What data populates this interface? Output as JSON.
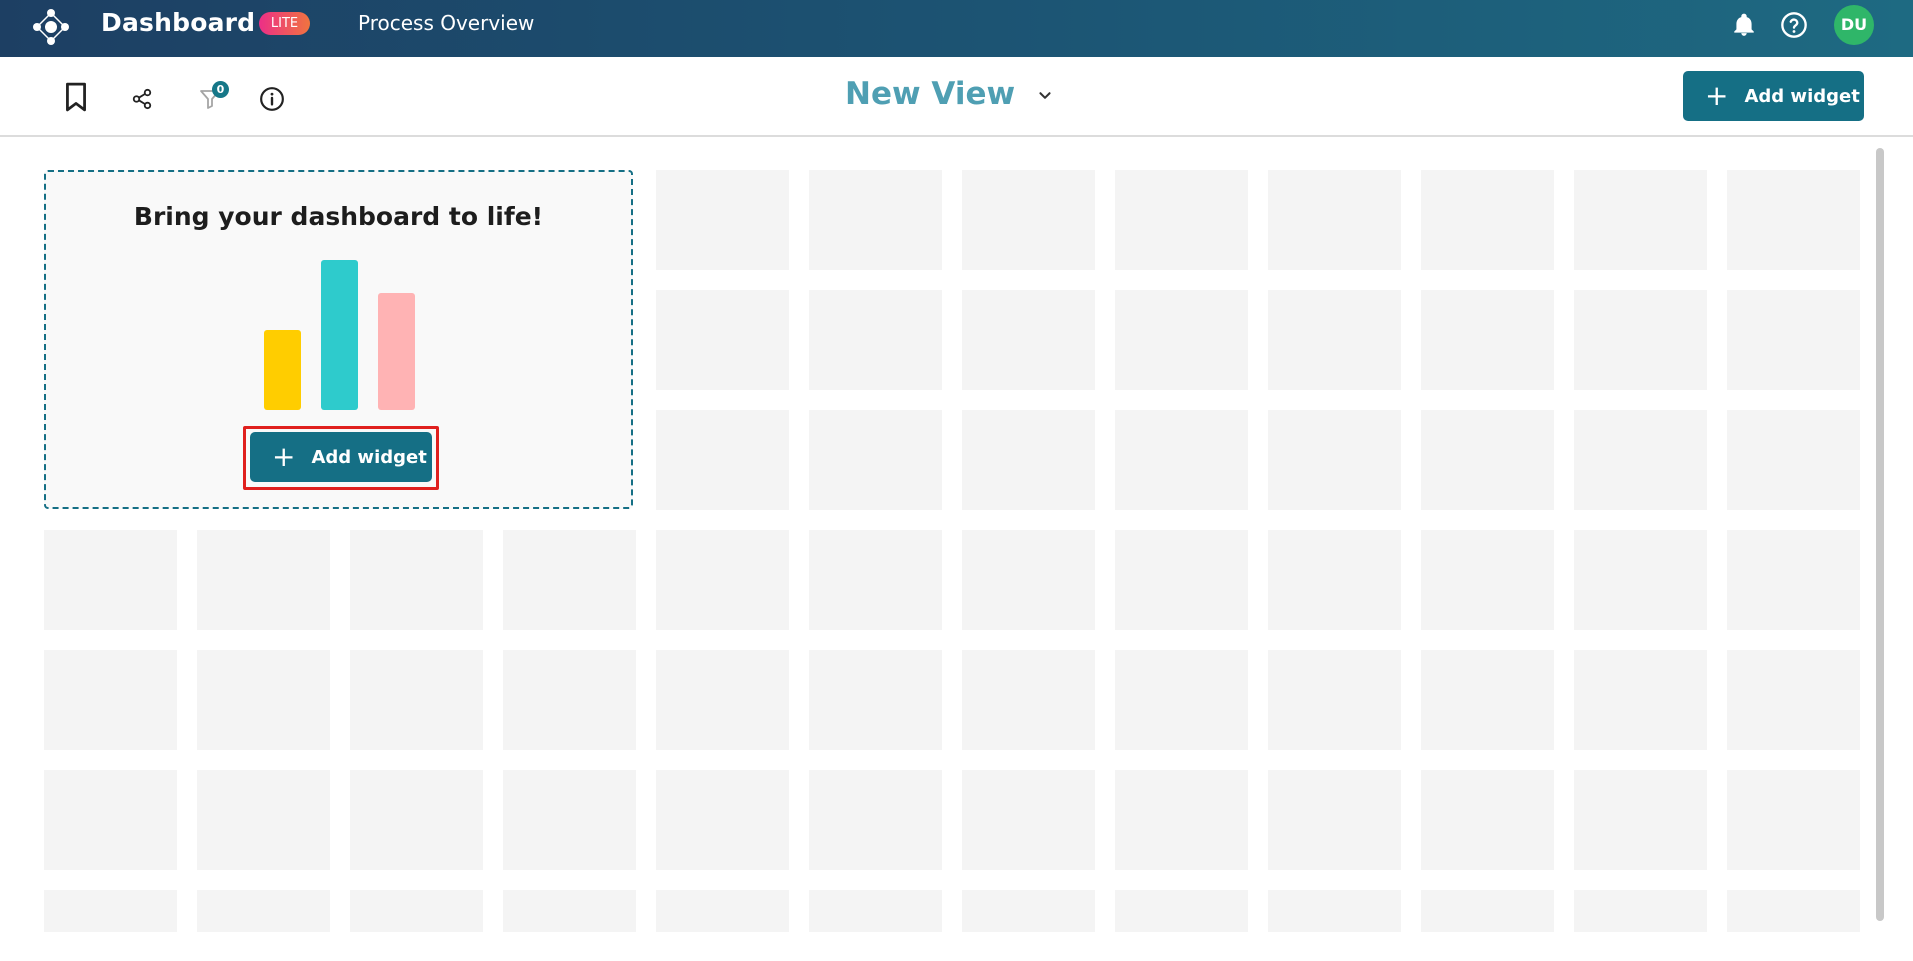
{
  "topbar": {
    "brand": "Dashboard",
    "badge": "LITE",
    "page_title": "Process Overview",
    "avatar_initials": "DU",
    "icons": [
      "app-logo-icon",
      "bell-icon",
      "help-icon"
    ]
  },
  "toolbar": {
    "icons": [
      "bookmark-icon",
      "share-icon",
      "filter-icon",
      "info-icon"
    ],
    "filter_count": "0",
    "view_title": "New View",
    "dropdown_icon": "chevron-down-icon",
    "add_widget_label": "Add widget"
  },
  "empty_state": {
    "title": "Bring your dashboard to life!",
    "add_widget_label": "Add widget",
    "illustration_bars": [
      {
        "color": "#ffcd00",
        "relative_height": 0.53
      },
      {
        "color": "#2ecbcc",
        "relative_height": 1.0
      },
      {
        "color": "#ffb3b4",
        "relative_height": 0.78
      }
    ]
  },
  "colors": {
    "primary": "#156f85",
    "view_title": "#4f9fb3",
    "avatar": "#2fb669",
    "highlight": "#e0201e"
  }
}
